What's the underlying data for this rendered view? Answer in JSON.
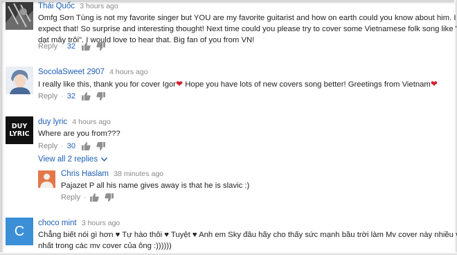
{
  "comments": [
    {
      "author": "Thái Quốc",
      "time": "3 hours ago",
      "text_lines": [
        "Omfg Sơn Tùng is not my favorite singer but YOU are my favorite guitarist and how on earth could you know about him. I never",
        "expect that! So surprise and  interesting thought! Next time could you please try to cover some Vietnamese folk song like \"bèo",
        "dạt mây trôi\". I would love to hear that. Big fan of you from VN!"
      ],
      "reply_label": "Reply",
      "likes": "32"
    },
    {
      "author": "SocolaSweet 2907",
      "time": "4 hours ago",
      "text_part1": "I really like this, thank you for cover Igor",
      "text_part2": " Hope you have lots of new covers song better! Greetings from Vietnam",
      "reply_label": "Reply",
      "likes": "32"
    },
    {
      "author": "duy lyric",
      "time": "4 hours ago",
      "avatar_text_top": "DUY",
      "avatar_text_bottom": "LYRIC",
      "text": "Where are you from???",
      "reply_label": "Reply",
      "likes": "30",
      "view_replies_label": "View all 2 replies"
    },
    {
      "author": "Chris Haslam",
      "time": "38 minutes ago",
      "text": "Pajazet P all his name gives away is that he is slavic :)",
      "reply_label": "Reply"
    },
    {
      "author": "choco mint",
      "time": "3 hours ago",
      "avatar_letter": "C",
      "text_line1": "Chẳng biết nói gì hơn ♥ Tự hào thôi ♥ Tuyệt ♥ Anh em Sky đâu hãy cho thấy sức mạnh bầu trời làm Mv cover này nhiều view",
      "text_line2": "nhất trong các mv cover của ông :))))))"
    }
  ],
  "separator": "·",
  "colors": {
    "link": "#1e5fb5",
    "heart": "#d21f2b",
    "choco_avatar": "#3b8fd6"
  },
  "icons": [
    "like-icon",
    "dislike-icon",
    "chevron-down-icon",
    "heart-icon"
  ]
}
